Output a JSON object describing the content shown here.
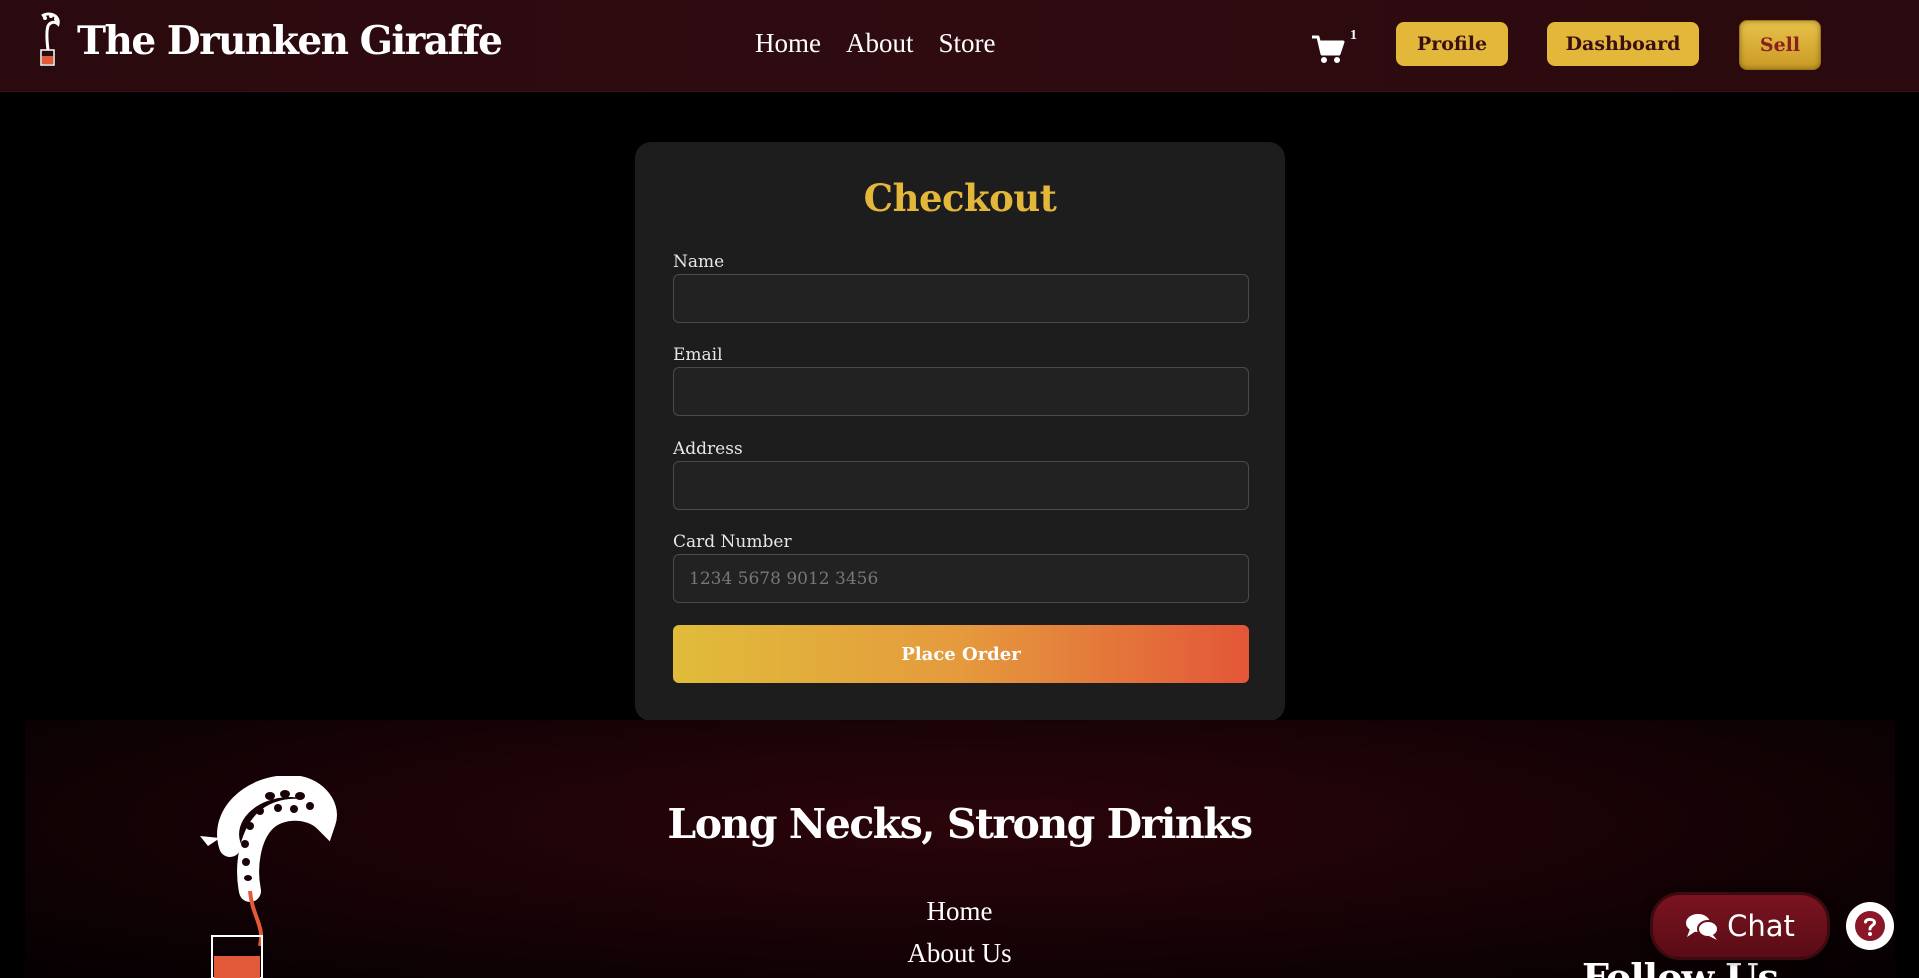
{
  "header": {
    "brand": "The Drunken Giraffe",
    "nav": [
      "Home",
      "About",
      "Store"
    ],
    "cart_count": "1",
    "buttons": {
      "profile": "Profile",
      "dashboard": "Dashboard",
      "sell": "Sell"
    }
  },
  "checkout": {
    "title": "Checkout",
    "fields": {
      "name": {
        "label": "Name",
        "value": "",
        "placeholder": ""
      },
      "email": {
        "label": "Email",
        "value": "",
        "placeholder": ""
      },
      "address": {
        "label": "Address",
        "value": "",
        "placeholder": ""
      },
      "card": {
        "label": "Card Number",
        "value": "",
        "placeholder": "1234 5678 9012 3456"
      }
    },
    "submit": "Place Order"
  },
  "footer": {
    "slogan": "Long Necks, Strong Drinks",
    "links": [
      "Home",
      "About Us"
    ],
    "follow": "Follow Us"
  },
  "widgets": {
    "chat": "Chat"
  },
  "colors": {
    "accent": "#e3b73a",
    "header_bg": "#2a0a0e",
    "card_bg": "#1d1d1d"
  },
  "icons": [
    "giraffe-logo-icon",
    "cart-icon",
    "chat-bubbles-icon",
    "help-icon"
  ]
}
